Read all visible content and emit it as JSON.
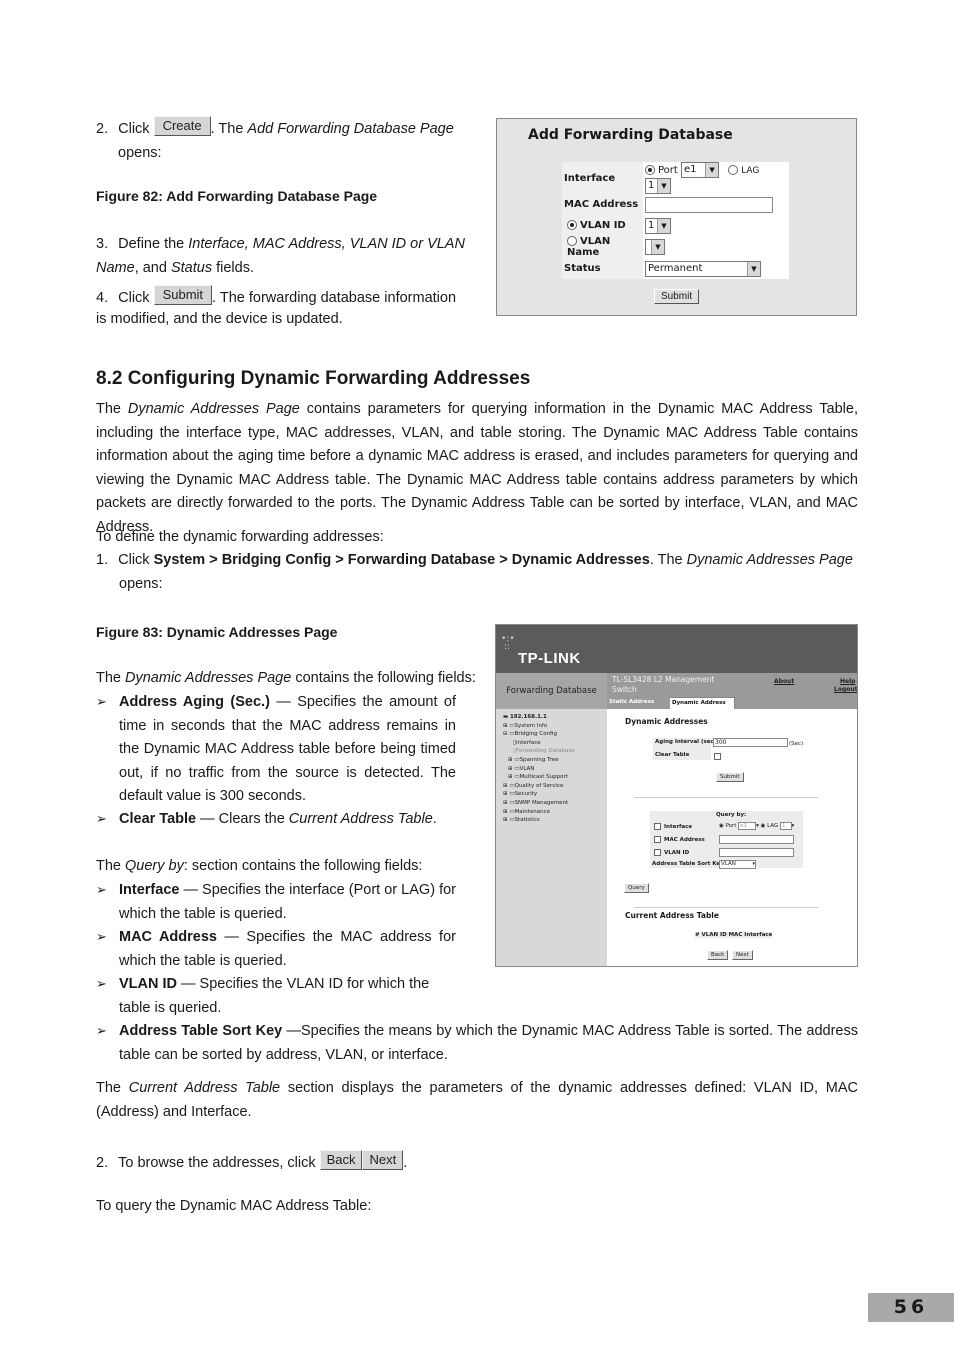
{
  "step2": {
    "number": "2.",
    "click": "Click",
    "button": "Create",
    "after": ". The ",
    "italic": "Add Forwarding Database Page",
    "end": "opens:"
  },
  "figure82": {
    "caption": "Figure 82: Add Forwarding Database Page",
    "title": "Add Forwarding Database",
    "interface_label": "Interface",
    "port_label": "Port",
    "port_value": "e1",
    "lag_label": "LAG",
    "lag_value": "1",
    "mac_label": "MAC Address",
    "mac_value": "",
    "vlan_id_label": "VLAN ID",
    "vlan_id_value": "1",
    "vlan_name_label": "VLAN Name",
    "vlan_name_value": "",
    "status_label": "Status",
    "status_value": "Permanent",
    "submit": "Submit"
  },
  "step3": {
    "number": "3.",
    "pre": "Define the ",
    "italic1": "Interface, MAC Address, VLAN ID or VLAN Name",
    "mid": ", and ",
    "italic2": "Status",
    "end": " fields."
  },
  "step4": {
    "number": "4.",
    "click": "Click",
    "button": "Submit",
    "after": ". The forwarding database information is modified, and the device is updated."
  },
  "section": {
    "heading": "8.2   Configuring Dynamic Forwarding Addresses",
    "intro_pre": "The ",
    "intro_italic": "Dynamic Addresses Page",
    "intro_rest": " contains parameters for querying information in the Dynamic MAC Address Table, including the interface type, MAC addresses, VLAN, and table storing. The Dynamic MAC Address Table contains information about the aging time before a dynamic MAC address is erased, and includes parameters for querying and viewing the Dynamic MAC Address table. The Dynamic MAC Address table contains address parameters by which packets are directly forwarded to the ports. The Dynamic Address Table can be sorted by interface, VLAN, and MAC Address.",
    "define": "To define the dynamic forwarding addresses:",
    "step1_number": "1.",
    "step1_click": "Click ",
    "step1_path": "System > Bridging Config > Forwarding Database > Dynamic Addresses",
    "step1_after": ". The ",
    "step1_italic": "Dynamic Addresses Page",
    "step1_end": "opens:"
  },
  "figure83": {
    "caption": "Figure 83: Dynamic Addresses Page",
    "logo": "TP-LINK",
    "section_title": "Forwarding Database",
    "product_line1": "TL-SL3428 L2 Management",
    "product_line2": "Switch",
    "about": "About",
    "help": "Help",
    "logout": "Logout",
    "tabs": [
      "Static Address",
      "Dynamic Address"
    ],
    "tree": [
      {
        "label": "192.168.1.1",
        "level": 0
      },
      {
        "label": "System Info",
        "level": 1
      },
      {
        "label": "Bridging Config",
        "level": 1
      },
      {
        "label": "Interface",
        "level": 2
      },
      {
        "label": "Forwarding Database",
        "level": 2
      },
      {
        "label": "Spanning Tree",
        "level": 2
      },
      {
        "label": "VLAN",
        "level": 2
      },
      {
        "label": "Multicast Support",
        "level": 2
      },
      {
        "label": "Quality of Service",
        "level": 1
      },
      {
        "label": "Security",
        "level": 1
      },
      {
        "label": "SNMP Management",
        "level": 1
      },
      {
        "label": "Maintenance",
        "level": 1
      },
      {
        "label": "Statistics",
        "level": 1
      }
    ],
    "heading": "Dynamic Addresses",
    "aging_label": "Aging Interval (secs)",
    "aging_value": "300",
    "aging_unit": "(Sec)",
    "clear_label": "Clear Table",
    "submit": "Submit",
    "query_by": "Query by:",
    "q_interface": "Interface",
    "q_port": "Port",
    "q_port_value": "e1",
    "q_lag": "LAG",
    "q_lag_value": "1",
    "q_mac": "MAC Address",
    "q_vlan": "VLAN ID",
    "sort_key_label": "Address Table Sort Key",
    "sort_key_value": "VLAN",
    "query_btn": "Query",
    "current_table": "Current Address Table",
    "table_header": "# VLAN ID MAC Interface",
    "back": "Back",
    "next": "Next"
  },
  "fields_intro": {
    "pre": "The ",
    "italic": "Dynamic Addresses Page",
    "rest": " contains the following fields:"
  },
  "fields": [
    {
      "name": "Address Aging (Sec.)",
      "desc": " — Specifies the amount of time in seconds that the MAC address remains in the Dynamic MAC Address table before being timed out, if no traffic from the source is detected. The default value is 300 seconds."
    },
    {
      "name": "Clear Table",
      "desc_pre": " — Clears the ",
      "desc_italic": "Current Address Table",
      "desc_end": "."
    }
  ],
  "query_intro": {
    "pre": "The ",
    "italic": "Query by",
    "rest": ": section contains the following fields:"
  },
  "query_fields": [
    {
      "name": "Interface",
      "desc": " — Specifies the interface (Port or LAG) for which the table is queried."
    },
    {
      "name": "MAC Address",
      "desc": " — Specifies the MAC address for which the table is queried."
    },
    {
      "name": "VLAN ID",
      "desc": " — Specifies the VLAN ID for which the table is queried."
    },
    {
      "name": "Address Table Sort Key",
      "desc": " —Specifies the means by which the Dynamic MAC Address Table is sorted. The address table can be sorted by address, VLAN, or interface."
    }
  ],
  "current_table_para": {
    "pre": "The ",
    "italic": "Current Address Table",
    "rest": " section displays the parameters of the dynamic addresses defined: VLAN ID, MAC (Address) and Interface."
  },
  "step_browse": {
    "number": "2.",
    "text": "To browse the addresses, click",
    "back": "Back",
    "next": "Next",
    "end": "."
  },
  "query_para": "To query the Dynamic MAC Address Table:",
  "page_number": "56",
  "bullet_glyph": "➢"
}
